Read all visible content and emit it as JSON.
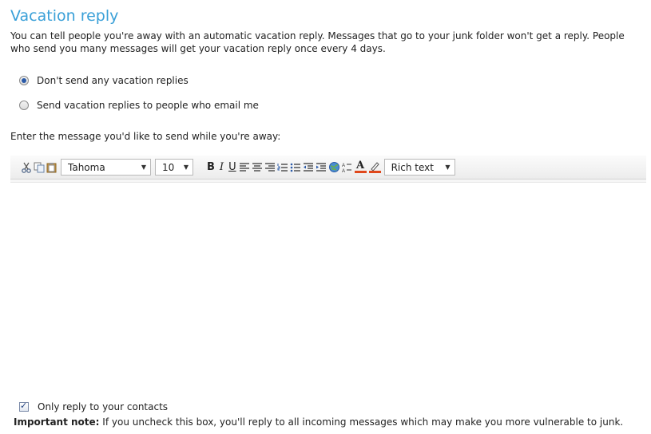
{
  "title": "Vacation reply",
  "description": "You can tell people you're away with an automatic vacation reply. Messages that go to your junk folder won't get a reply. People who send you many messages will get your vacation reply once every 4 days.",
  "options": [
    {
      "label": "Don't send any vacation replies",
      "selected": true
    },
    {
      "label": "Send vacation replies to people who email me",
      "selected": false
    }
  ],
  "prompt": "Enter the message you'd like to send while you're away:",
  "toolbar": {
    "font": "Tahoma",
    "size": "10",
    "bold": "B",
    "italic": "I",
    "underline": "U",
    "font_color": "A",
    "mode": "Rich text",
    "icons": [
      "cut-icon",
      "copy-icon",
      "paste-icon",
      "align-left-icon",
      "align-center-icon",
      "align-right-icon",
      "numbered-list-icon",
      "bulleted-list-icon",
      "outdent-icon",
      "indent-icon",
      "insert-link-icon",
      "spell-check-icon",
      "font-color-icon",
      "highlight-icon"
    ]
  },
  "editor_value": "",
  "contacts_only": {
    "label": "Only reply to your contacts",
    "checked": true
  },
  "note": {
    "bold": "Important note:",
    "text": " If you uncheck this box, you'll reply to all incoming messages which may make you more vulnerable to junk."
  }
}
